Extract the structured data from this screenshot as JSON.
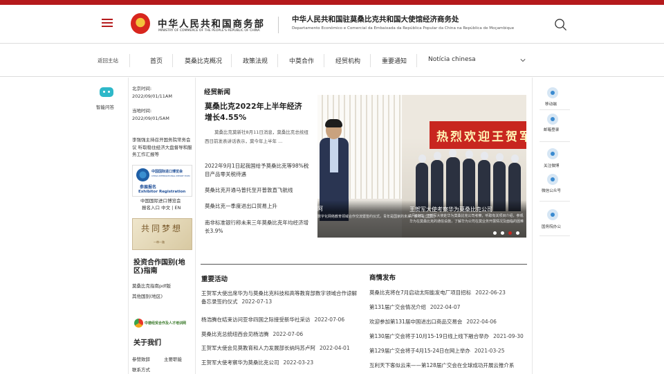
{
  "header": {
    "ministry_cn": "中华人民共和国商务部",
    "ministry_en": "MINISTRY OF COMMERCE OF THE PEOPLE'S REPUBLIC OF CHINA",
    "office_cn": "中华人民共和国驻莫桑比克共和国大使馆经济商务处",
    "office_pt": "Departamento Econômico e Comercial da Embaixada da República Popular da China na República de Moçambique"
  },
  "nav": {
    "back": "返回主站",
    "items": [
      "首页",
      "莫桑比克概况",
      "政策法规",
      "中莫合作",
      "经贸机构",
      "重要通知",
      "Notícia chinesa"
    ]
  },
  "left": {
    "robot_label": "智能问答",
    "beijing_time_label": "北京时间:",
    "beijing_time": "2022/09/01/11AM",
    "local_time_label": "当地时间:",
    "local_time": "2022/09/01/5AM",
    "headline": "李强强主持召开国务院常务会议 听取稳住经济大盘督导和服务工作汇报等",
    "expo_cn": "中国国际进口博览会",
    "expo_en": "CHINA INTERNATIONAL IMPORT EXPO",
    "expo_reg_cn": "参展报名",
    "expo_reg_en": "Exhibitor Registration",
    "expo_link": "中国国际进口博览会",
    "expo_links2": "报名入口 中文 | EN",
    "dream_text": "共同梦想",
    "dream_sub": "一带一路",
    "guide_title": "投资合作国别(地区)指南",
    "guide_pdf": "莫桑比克指南pdf版",
    "guide_other": "其他国别(地区)",
    "talent_text": "中德经贸合作及人才培训网",
    "about_title": "关于我们",
    "about_1": "参赞致辞",
    "about_2": "主要职能",
    "about_3": "联系方式"
  },
  "news": {
    "section_title": "经贸新闻",
    "lead_title": "莫桑比克2022年上半年经济增长4.55%",
    "lead_summary": "莫桑比克莫新社8月11日消息，莫桑比克总统纽西日前发表讲话表示，莫今年上半年 ...",
    "items": [
      "2022年9月1日起我国给予莫桑比克等98%税目产品零关税待遇",
      "莫桑比克开通马普托至开普敦直飞航线",
      "莫桑比克一季度进出口贸易上升",
      "南非标准银行称未来三年莫桑比克年均经济增长3.9%"
    ]
  },
  "carousel": {
    "left_caption": "阿",
    "left_sub": "数字化网络教育领域合作交流暨签约仪式，青年是国家的未来，教育是立国之",
    "caption": "王贺军大使考察华为莫桑比克公司",
    "caption_sub": "3月22日，王贺军大使赴华为莫桑比克公司考察，听取有关项目介绍，参观华为在莫桑比克的通信设施，了解华为公司在莫业务开展情况及面临的困难",
    "banner_text": "热烈欢迎王贺军大使莅临华"
  },
  "important": {
    "title": "重要活动",
    "items": [
      {
        "text": "王贺军大使出席华为与莫桑比克科技和高等教育部数字领域合作谅解备忘录签约仪式",
        "date": "2022-07-13"
      },
      {
        "text": "杨浩腾在结束访问亚非四国之际接受新华社采访",
        "date": "2022-07-06"
      },
      {
        "text": "莫桑比克总统纽西会见杨洁腾",
        "date": "2022-07-06"
      },
      {
        "text": "王贺军大使会见莫教育和人力发展部长纳玛苏卢阿",
        "date": "2022-04-01"
      },
      {
        "text": "王贺军大使考察华为莫桑比克公司",
        "date": "2022-03-23"
      }
    ]
  },
  "trade": {
    "title": "商情发布",
    "items": [
      {
        "text": "莫桑比克将在7月启动太阳能发电厂项目招标",
        "date": "2022-06-23"
      },
      {
        "text": "第131届广交会情况介绍",
        "date": "2022-04-07"
      },
      {
        "text": "欢迎参加第131届中国进出口商品交易会",
        "date": "2022-04-06"
      },
      {
        "text": "第130届广交会将于10月15-19日线上线下融合举办",
        "date": "2021-09-30"
      },
      {
        "text": "第129届广交会将于4月15-24日在网上举办",
        "date": "2021-03-25"
      },
      {
        "text": "互利天下客似云来——第128届广交会在全球成功开展云推介系",
        "date": ""
      }
    ]
  },
  "right": {
    "items": [
      "移动端",
      "邮箱登录",
      "关注微博",
      "微信公众号",
      "国务院办公"
    ]
  },
  "colors": {
    "brand_red": "#b51a1c",
    "accent_blue": "#3a8ad0"
  }
}
